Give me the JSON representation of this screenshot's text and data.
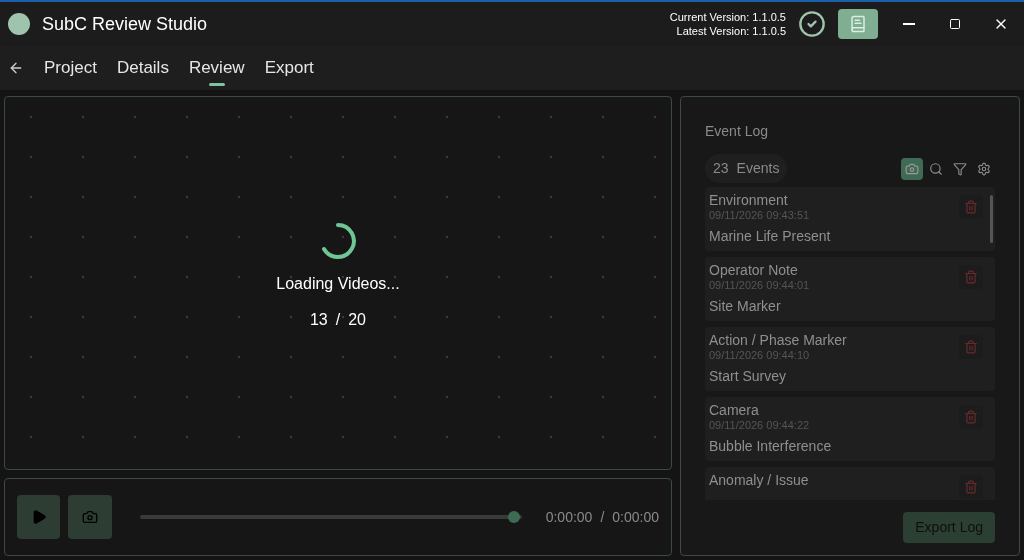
{
  "window": {
    "title": "SubC Review Studio",
    "current_version": "Current Version: 1.1.0.5",
    "latest_version": "Latest Version: 1.1.0.5"
  },
  "tabs": [
    {
      "label": "Project",
      "selected": false
    },
    {
      "label": "Details",
      "selected": false
    },
    {
      "label": "Review",
      "selected": true
    },
    {
      "label": "Export",
      "selected": false
    }
  ],
  "viewer": {
    "loading_text": "Loading Videos...",
    "loaded": "13",
    "separator": "/",
    "total": "20"
  },
  "player": {
    "level": 0.98,
    "elapsed": "0:00:00",
    "separator": "/",
    "duration": "0:00:00"
  },
  "event_log": {
    "title": "Event Log",
    "count": "23",
    "count_label": "Events",
    "tools": [
      {
        "kind": "camera",
        "selected": true
      },
      {
        "kind": "search",
        "selected": false
      },
      {
        "kind": "filter",
        "selected": false
      },
      {
        "kind": "settings",
        "selected": false
      }
    ],
    "events": [
      {
        "category": "Environment",
        "time": "09/11/2026 09:43:51",
        "label": "Marine Life Present"
      },
      {
        "category": "Operator Note",
        "time": "09/11/2026 09:44:01",
        "label": "Site Marker"
      },
      {
        "category": "Action / Phase Marker",
        "time": "09/11/2026 09:44:10",
        "label": "Start Survey"
      },
      {
        "category": "Camera",
        "time": "09/11/2026 09:44:22",
        "label": "Bubble Interference"
      },
      {
        "category": "Anomaly / Issue"
      }
    ],
    "export_button": "Export Log"
  }
}
